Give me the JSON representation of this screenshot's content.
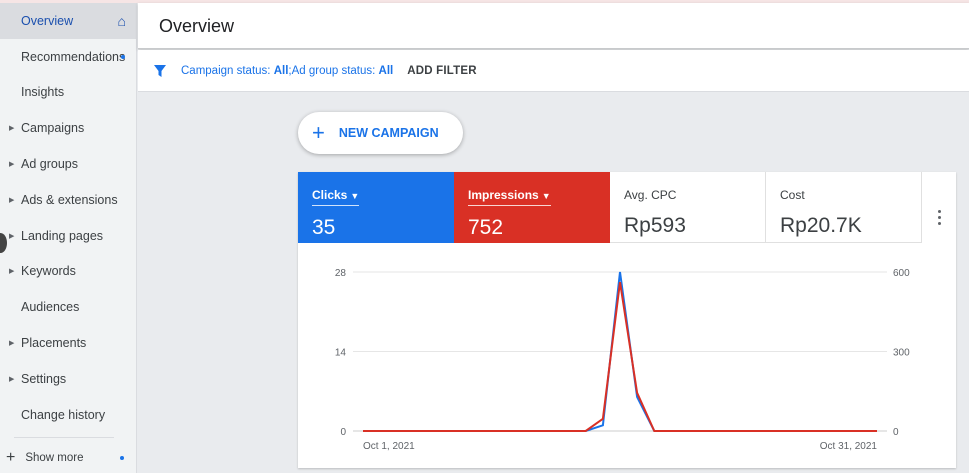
{
  "header": {
    "title": "Overview"
  },
  "sidebar": {
    "items": [
      {
        "label": "Overview",
        "active": true,
        "icon": "home-icon"
      },
      {
        "label": "Recommendations",
        "dot": true
      },
      {
        "label": "Insights"
      },
      {
        "label": "Campaigns",
        "expandable": true
      },
      {
        "label": "Ad groups",
        "expandable": true
      },
      {
        "label": "Ads & extensions",
        "expandable": true
      },
      {
        "label": "Landing pages",
        "expandable": true
      },
      {
        "label": "Keywords",
        "expandable": true
      },
      {
        "label": "Audiences"
      },
      {
        "label": "Placements",
        "expandable": true
      },
      {
        "label": "Settings",
        "expandable": true
      },
      {
        "label": "Change history"
      }
    ],
    "show_more": "Show more"
  },
  "filters": {
    "campaign_label": "Campaign status: ",
    "campaign_value": "All",
    "sep": "; ",
    "adgroup_label": "Ad group status: ",
    "adgroup_value": "All",
    "add_filter": "ADD FILTER"
  },
  "new_campaign": "NEW CAMPAIGN",
  "metrics": [
    {
      "label": "Clicks",
      "value": "35",
      "color": "#1a73e8"
    },
    {
      "label": "Impressions",
      "value": "752",
      "color": "#d93025"
    },
    {
      "label": "Avg. CPC",
      "value": "Rp593"
    },
    {
      "label": "Cost",
      "value": "Rp20.7K"
    }
  ],
  "chart_data": {
    "type": "line",
    "x": [
      1,
      2,
      3,
      4,
      5,
      6,
      7,
      8,
      9,
      10,
      11,
      12,
      13,
      14,
      15,
      16,
      17,
      18,
      19,
      20,
      21,
      22,
      23,
      24,
      25,
      26,
      27,
      28,
      29,
      30,
      31
    ],
    "x_tick_labels": [
      "Oct 1, 2021",
      "Oct 31, 2021"
    ],
    "series": [
      {
        "name": "Clicks",
        "axis": "left",
        "color": "#1a73e8",
        "values": [
          0,
          0,
          0,
          0,
          0,
          0,
          0,
          0,
          0,
          0,
          0,
          0,
          0,
          0,
          1,
          28,
          6,
          0,
          0,
          0,
          0,
          0,
          0,
          0,
          0,
          0,
          0,
          0,
          0,
          0,
          0
        ]
      },
      {
        "name": "Impressions",
        "axis": "right",
        "color": "#d93025",
        "values": [
          0,
          0,
          0,
          0,
          0,
          0,
          0,
          0,
          0,
          0,
          0,
          0,
          0,
          0,
          46,
          562,
          144,
          0,
          0,
          0,
          0,
          0,
          0,
          0,
          0,
          0,
          0,
          0,
          0,
          0,
          0
        ]
      }
    ],
    "y_left": {
      "ticks": [
        "0",
        "14",
        "28"
      ],
      "range": [
        0,
        28
      ]
    },
    "y_right": {
      "ticks": [
        "0",
        "300",
        "600"
      ],
      "range": [
        0,
        600
      ]
    },
    "grid": true
  }
}
